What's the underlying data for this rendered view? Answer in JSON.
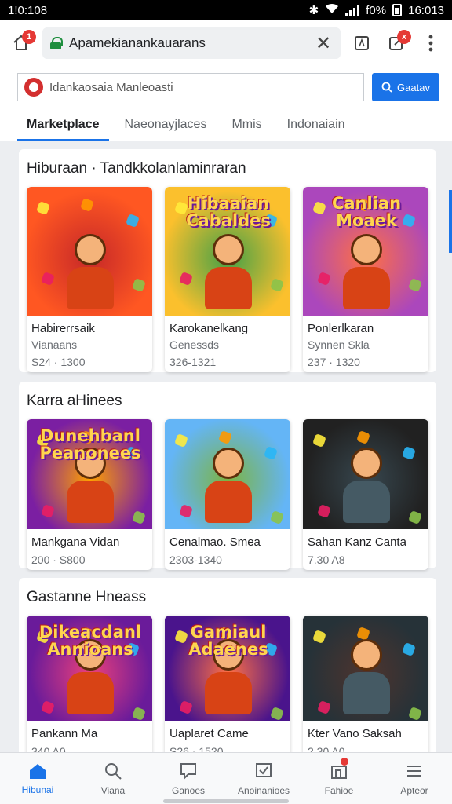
{
  "status_bar": {
    "time_left": "1!0:108",
    "battery": "f0%",
    "time_right": "16:013"
  },
  "toolbar": {
    "home_badge": "1",
    "url": "Apamekianankauarans",
    "edit_badge": "x"
  },
  "search": {
    "placeholder": "Idankaosaia Manleoasti",
    "button_label": "Gaatav"
  },
  "tabs": [
    {
      "label": "Marketplace"
    },
    {
      "label": "Naeonayjlaces"
    },
    {
      "label": "Mmis"
    },
    {
      "label": "Indonaiain"
    }
  ],
  "sections": [
    {
      "title": "Hiburaan · Tandkkolanlaminraran",
      "cards": [
        {
          "name": "Habirerrsaik",
          "sub": "Vianaans",
          "price": "S24 · 1300",
          "colors": [
            "#ff5722",
            "#c62828"
          ]
        },
        {
          "name": "Karokanelkang",
          "sub": "Genessds",
          "price": "326-1321",
          "art_text": "Hibaaian\nCabaldes",
          "colors": [
            "#fbc02d",
            "#43a047"
          ]
        },
        {
          "name": "Ponlerlkaran",
          "sub": "Synnen Skla",
          "price": "237 · 1320",
          "art_text": "Canlian\nMoaek",
          "colors": [
            "#ab47bc",
            "#ff7043"
          ]
        }
      ]
    },
    {
      "title": "Karra aHinees",
      "cards": [
        {
          "name": "Mankgana Vidan",
          "sub": "",
          "price": "200 · S800",
          "art_text": "Dunehbanl\nPeanonees",
          "colors": [
            "#7b1fa2",
            "#ffa000"
          ]
        },
        {
          "name": "Cenalmao. Smea",
          "sub": "",
          "price": "2303-1340",
          "colors": [
            "#64b5f6",
            "#7cb342"
          ]
        },
        {
          "name": "Sahan Kanz Canta",
          "sub": "",
          "price": "7.30 A8",
          "colors": [
            "#212121",
            "#37474f"
          ]
        }
      ]
    },
    {
      "title": "Gastanne Hneass",
      "cards": [
        {
          "name": "Pankann Ma",
          "sub": "",
          "price": "340 A0",
          "art_text": "Dikeacdanl\nAnnioans",
          "colors": [
            "#6a1b9a",
            "#ec407a"
          ]
        },
        {
          "name": "Uaplaret Came",
          "sub": "",
          "price": "S26 · 1520",
          "art_text": "Gamiaul\nAdaenes",
          "colors": [
            "#4a148c",
            "#ff7043"
          ]
        },
        {
          "name": "Kter Vano Saksah",
          "sub": "",
          "price": "2.30 A0",
          "colors": [
            "#263238",
            "#4e342e"
          ]
        }
      ]
    }
  ],
  "bottom_nav": [
    {
      "label": "Hibunai",
      "icon": "home-icon",
      "active": true
    },
    {
      "label": "Viana",
      "icon": "search-icon"
    },
    {
      "label": "Ganoes",
      "icon": "chat-icon"
    },
    {
      "label": "Anoinanioes",
      "icon": "checkbox-icon"
    },
    {
      "label": "Fahioe",
      "icon": "store-icon",
      "badge": true
    },
    {
      "label": "Apteor",
      "icon": "menu-icon"
    }
  ]
}
